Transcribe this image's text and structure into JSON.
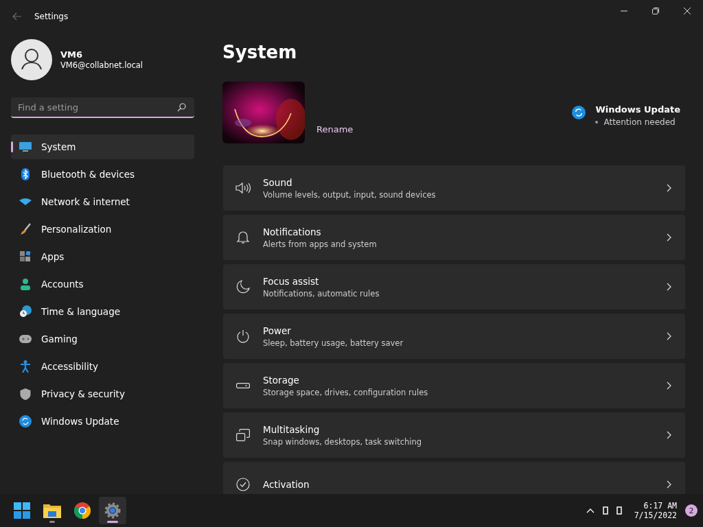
{
  "window": {
    "title": "Settings"
  },
  "account": {
    "name": "VM6",
    "email": "VM6@collabnet.local"
  },
  "search": {
    "placeholder": "Find a setting"
  },
  "sidebar": {
    "items": [
      {
        "label": "System",
        "selected": true
      },
      {
        "label": "Bluetooth & devices",
        "selected": false
      },
      {
        "label": "Network & internet",
        "selected": false
      },
      {
        "label": "Personalization",
        "selected": false
      },
      {
        "label": "Apps",
        "selected": false
      },
      {
        "label": "Accounts",
        "selected": false
      },
      {
        "label": "Time & language",
        "selected": false
      },
      {
        "label": "Gaming",
        "selected": false
      },
      {
        "label": "Accessibility",
        "selected": false
      },
      {
        "label": "Privacy & security",
        "selected": false
      },
      {
        "label": "Windows Update",
        "selected": false
      }
    ]
  },
  "page": {
    "title": "System"
  },
  "device": {
    "rename": "Rename"
  },
  "update": {
    "title": "Windows Update",
    "status": "Attention needed"
  },
  "settings": [
    {
      "title": "Sound",
      "description": "Volume levels, output, input, sound devices"
    },
    {
      "title": "Notifications",
      "description": "Alerts from apps and system"
    },
    {
      "title": "Focus assist",
      "description": "Notifications, automatic rules"
    },
    {
      "title": "Power",
      "description": "Sleep, battery usage, battery saver"
    },
    {
      "title": "Storage",
      "description": "Storage space, drives, configuration rules"
    },
    {
      "title": "Multitasking",
      "description": "Snap windows, desktops, task switching"
    },
    {
      "title": "Activation"
    }
  ],
  "taskbar": {
    "apps": [
      {
        "running": false,
        "active": false
      },
      {
        "running": true,
        "active": false
      },
      {
        "running": false,
        "active": false
      },
      {
        "running": true,
        "active": true
      }
    ]
  },
  "clock": {
    "time": "6:17 AM",
    "date": "7/15/2022"
  },
  "notifications": {
    "count": "2"
  }
}
